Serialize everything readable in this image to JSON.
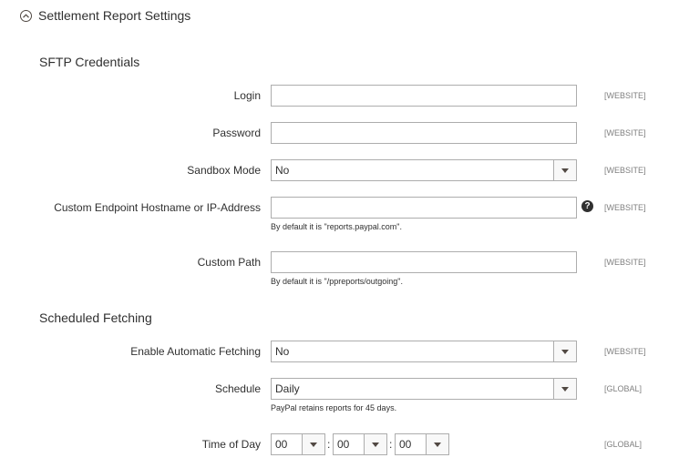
{
  "section": {
    "title": "Settlement Report Settings",
    "collapse_icon": "chevron-up-circle-icon"
  },
  "groups": {
    "sftp": "SFTP Credentials",
    "scheduled": "Scheduled Fetching"
  },
  "fields": {
    "login": {
      "label": "Login",
      "value": "",
      "scope": "[WEBSITE]"
    },
    "password": {
      "label": "Password",
      "value": "",
      "scope": "[WEBSITE]"
    },
    "sandbox": {
      "label": "Sandbox Mode",
      "value": "No",
      "scope": "[WEBSITE]"
    },
    "endpoint": {
      "label": "Custom Endpoint Hostname or IP-Address",
      "value": "",
      "scope": "[WEBSITE]",
      "note": "By default it is \"reports.paypal.com\".",
      "help_glyph": "?"
    },
    "path": {
      "label": "Custom Path",
      "value": "",
      "scope": "[WEBSITE]",
      "note": "By default it is \"/ppreports/outgoing\"."
    },
    "auto_fetch": {
      "label": "Enable Automatic Fetching",
      "value": "No",
      "scope": "[WEBSITE]"
    },
    "schedule": {
      "label": "Schedule",
      "value": "Daily",
      "scope": "[GLOBAL]",
      "note": "PayPal retains reports for 45 days."
    },
    "time_of_day": {
      "label": "Time of Day",
      "hour": "00",
      "minute": "00",
      "second": "00",
      "separator": ":",
      "scope": "[GLOBAL]"
    }
  }
}
